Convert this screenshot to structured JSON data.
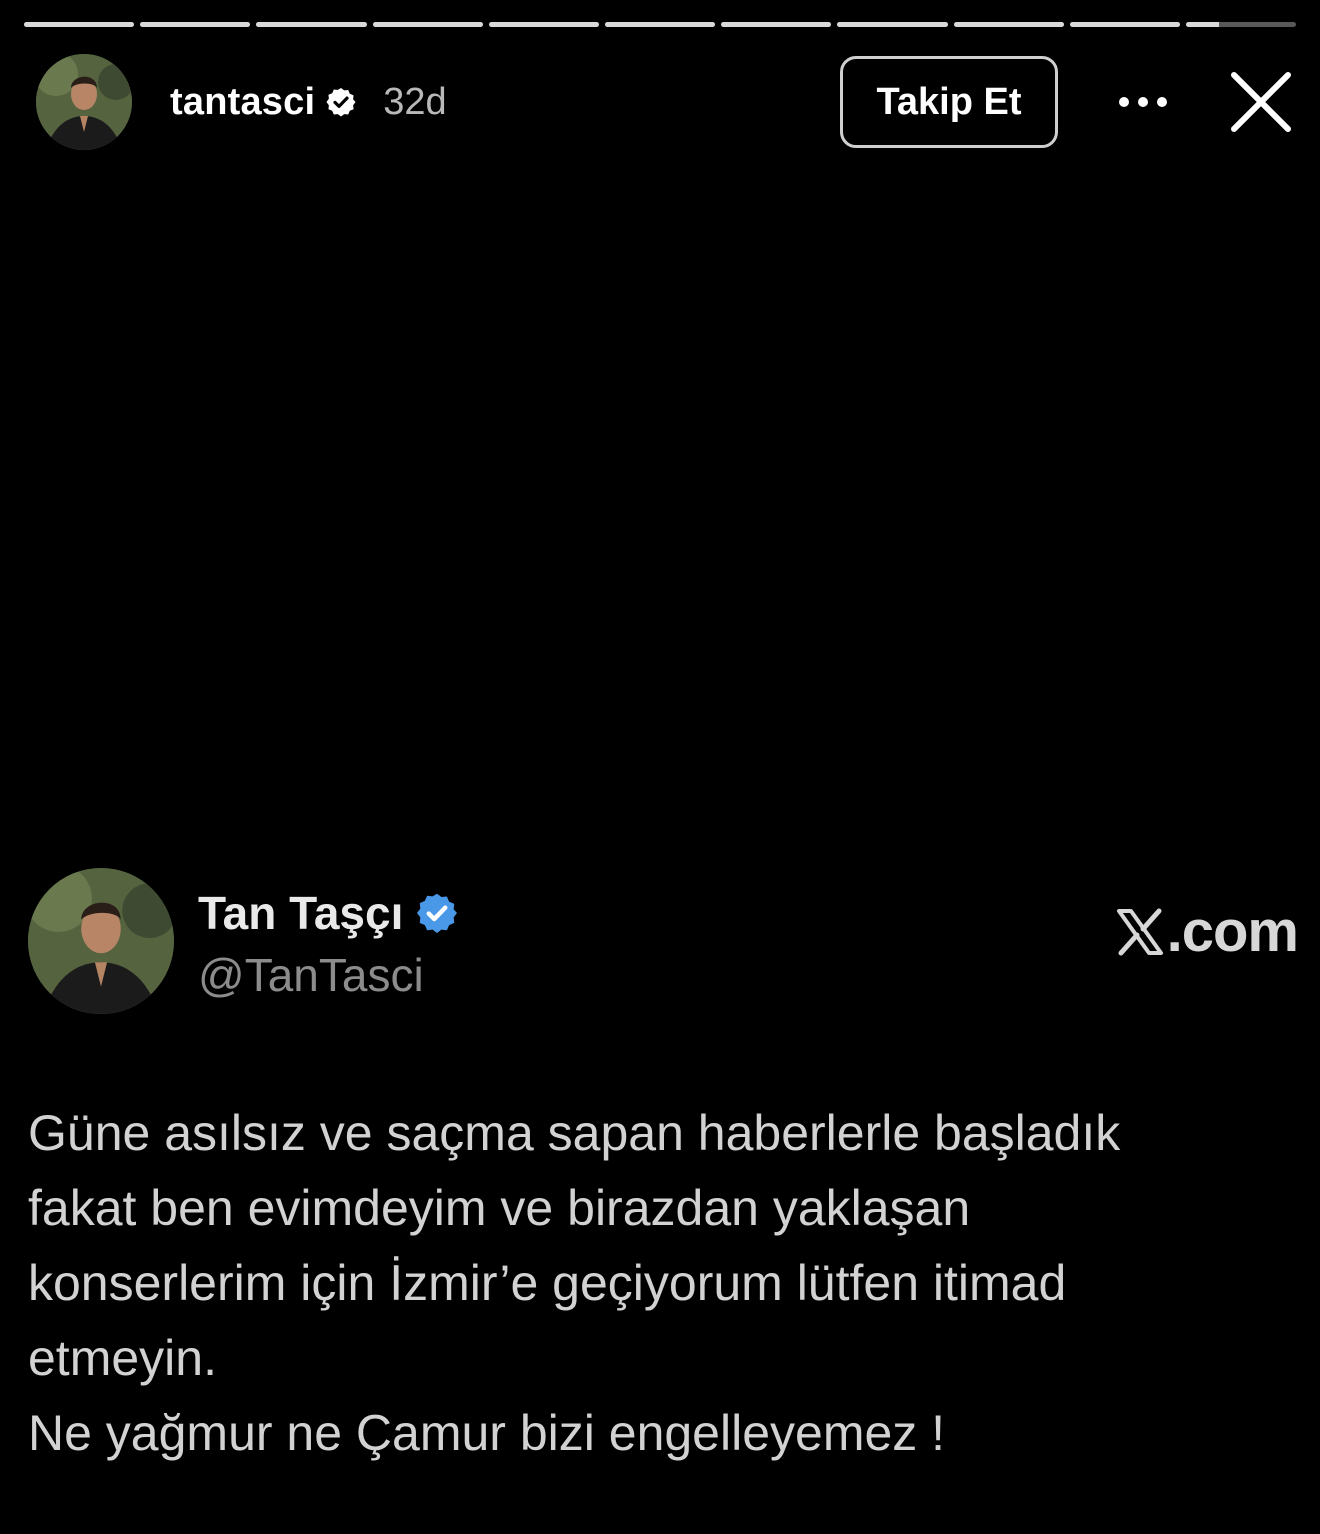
{
  "story": {
    "segment_count": 11,
    "current_segment_progress": 0.3
  },
  "header": {
    "username": "tantasci",
    "time_ago": "32d",
    "follow_label": "Takip Et",
    "more_icon": "more-horizontal-icon",
    "close_icon": "close-icon"
  },
  "tweet": {
    "display_name": "Tan Taşçı",
    "handle": "@TanTasci",
    "brand_suffix": ".com",
    "lines": [
      "Güne asılsız ve saçma sapan haberlerle başladık",
      "fakat ben evimdeyim ve birazdan yaklaşan",
      "konserlerim için İzmir’e geçiyorum lütfen itimad",
      "etmeyin.",
      "Ne yağmur ne Çamur bizi engelleyemez !"
    ]
  },
  "colors": {
    "background": "#000000",
    "verified_blue": "#4a99e9",
    "handle_gray": "#8c8c8c",
    "body_text": "#d2d2d2"
  }
}
